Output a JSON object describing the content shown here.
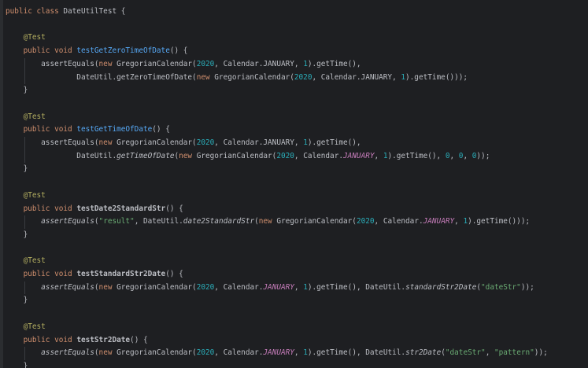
{
  "lines": [
    [
      {
        "t": "public class ",
        "c": "kw"
      },
      {
        "t": "DateUtilTest {",
        "c": "plain"
      }
    ],
    [],
    [
      {
        "t": "    @Test",
        "c": "ann"
      }
    ],
    [
      {
        "t": "    public void ",
        "c": "kw"
      },
      {
        "t": "testGetZeroTimeOfDate",
        "c": "fn"
      },
      {
        "t": "() {",
        "c": "plain"
      }
    ],
    [
      {
        "t": "        assertEquals(",
        "c": "plain"
      },
      {
        "t": "new ",
        "c": "kw"
      },
      {
        "t": "GregorianCalendar(",
        "c": "plain"
      },
      {
        "t": "2020",
        "c": "num"
      },
      {
        "t": ", Calendar.JANUARY, ",
        "c": "plain"
      },
      {
        "t": "1",
        "c": "num"
      },
      {
        "t": ").getTime(),",
        "c": "plain"
      }
    ],
    [
      {
        "t": "                DateUtil.getZeroTimeOfDate(",
        "c": "plain"
      },
      {
        "t": "new ",
        "c": "kw"
      },
      {
        "t": "GregorianCalendar(",
        "c": "plain"
      },
      {
        "t": "2020",
        "c": "num"
      },
      {
        "t": ", Calendar.JANUARY, ",
        "c": "plain"
      },
      {
        "t": "1",
        "c": "num"
      },
      {
        "t": ").getTime()));",
        "c": "plain"
      }
    ],
    [
      {
        "t": "    }",
        "c": "plain"
      }
    ],
    [],
    [
      {
        "t": "    @Test",
        "c": "ann"
      }
    ],
    [
      {
        "t": "    public void ",
        "c": "kw"
      },
      {
        "t": "testGetTimeOfDate",
        "c": "fn"
      },
      {
        "t": "() {",
        "c": "plain"
      }
    ],
    [
      {
        "t": "        assertEquals(",
        "c": "plain"
      },
      {
        "t": "new ",
        "c": "kw"
      },
      {
        "t": "GregorianCalendar(",
        "c": "plain"
      },
      {
        "t": "2020",
        "c": "num"
      },
      {
        "t": ", Calendar.JANUARY, ",
        "c": "plain"
      },
      {
        "t": "1",
        "c": "num"
      },
      {
        "t": ").getTime(),",
        "c": "plain"
      }
    ],
    [
      {
        "t": "                DateUtil.",
        "c": "plain"
      },
      {
        "t": "getTimeOfDate",
        "c": "sfn"
      },
      {
        "t": "(",
        "c": "plain"
      },
      {
        "t": "new ",
        "c": "kw"
      },
      {
        "t": "GregorianCalendar(",
        "c": "plain"
      },
      {
        "t": "2020",
        "c": "num"
      },
      {
        "t": ", Calendar.",
        "c": "plain"
      },
      {
        "t": "JANUARY",
        "c": "stat"
      },
      {
        "t": ", ",
        "c": "plain"
      },
      {
        "t": "1",
        "c": "num"
      },
      {
        "t": ").getTime(), ",
        "c": "plain"
      },
      {
        "t": "0",
        "c": "num"
      },
      {
        "t": ", ",
        "c": "plain"
      },
      {
        "t": "0",
        "c": "num"
      },
      {
        "t": ", ",
        "c": "plain"
      },
      {
        "t": "0",
        "c": "num"
      },
      {
        "t": "));",
        "c": "plain"
      }
    ],
    [
      {
        "t": "    }",
        "c": "plain"
      }
    ],
    [],
    [
      {
        "t": "    @Test",
        "c": "ann"
      }
    ],
    [
      {
        "t": "    public void ",
        "c": "kw"
      },
      {
        "t": "testDate2StandardStr",
        "c": "plain bold"
      },
      {
        "t": "() {",
        "c": "plain"
      }
    ],
    [
      {
        "t": "        ",
        "c": "plain"
      },
      {
        "t": "assertEquals",
        "c": "sfn"
      },
      {
        "t": "(",
        "c": "plain"
      },
      {
        "t": "\"result\"",
        "c": "str"
      },
      {
        "t": ", DateUtil.",
        "c": "plain"
      },
      {
        "t": "date2StandardStr",
        "c": "sfn"
      },
      {
        "t": "(",
        "c": "plain"
      },
      {
        "t": "new ",
        "c": "kw"
      },
      {
        "t": "GregorianCalendar(",
        "c": "plain"
      },
      {
        "t": "2020",
        "c": "num"
      },
      {
        "t": ", Calendar.",
        "c": "plain"
      },
      {
        "t": "JANUARY",
        "c": "stat"
      },
      {
        "t": ", ",
        "c": "plain"
      },
      {
        "t": "1",
        "c": "num"
      },
      {
        "t": ").getTime()));",
        "c": "plain"
      }
    ],
    [
      {
        "t": "    }",
        "c": "plain"
      }
    ],
    [],
    [
      {
        "t": "    @Test",
        "c": "ann"
      }
    ],
    [
      {
        "t": "    public void ",
        "c": "kw"
      },
      {
        "t": "testStandardStr2Date",
        "c": "plain bold"
      },
      {
        "t": "() {",
        "c": "plain"
      }
    ],
    [
      {
        "t": "        ",
        "c": "plain"
      },
      {
        "t": "assertEquals",
        "c": "sfn"
      },
      {
        "t": "(",
        "c": "plain"
      },
      {
        "t": "new ",
        "c": "kw"
      },
      {
        "t": "GregorianCalendar(",
        "c": "plain"
      },
      {
        "t": "2020",
        "c": "num"
      },
      {
        "t": ", Calendar.",
        "c": "plain"
      },
      {
        "t": "JANUARY",
        "c": "stat"
      },
      {
        "t": ", ",
        "c": "plain"
      },
      {
        "t": "1",
        "c": "num"
      },
      {
        "t": ").getTime(), DateUtil.",
        "c": "plain"
      },
      {
        "t": "standardStr2Date",
        "c": "sfn"
      },
      {
        "t": "(",
        "c": "plain"
      },
      {
        "t": "\"dateStr\"",
        "c": "str"
      },
      {
        "t": "));",
        "c": "plain"
      }
    ],
    [
      {
        "t": "    }",
        "c": "plain"
      }
    ],
    [],
    [
      {
        "t": "    @Test",
        "c": "ann"
      }
    ],
    [
      {
        "t": "    public void ",
        "c": "kw"
      },
      {
        "t": "testStr2Date",
        "c": "plain bold"
      },
      {
        "t": "() {",
        "c": "plain"
      }
    ],
    [
      {
        "t": "        ",
        "c": "plain"
      },
      {
        "t": "assertEquals",
        "c": "sfn"
      },
      {
        "t": "(",
        "c": "plain"
      },
      {
        "t": "new ",
        "c": "kw"
      },
      {
        "t": "GregorianCalendar(",
        "c": "plain"
      },
      {
        "t": "2020",
        "c": "num"
      },
      {
        "t": ", Calendar.",
        "c": "plain"
      },
      {
        "t": "JANUARY",
        "c": "stat"
      },
      {
        "t": ", ",
        "c": "plain"
      },
      {
        "t": "1",
        "c": "num"
      },
      {
        "t": ").getTime(), DateUtil.",
        "c": "plain"
      },
      {
        "t": "str2Date",
        "c": "sfn"
      },
      {
        "t": "(",
        "c": "plain"
      },
      {
        "t": "\"dateStr\"",
        "c": "str"
      },
      {
        "t": ", ",
        "c": "plain"
      },
      {
        "t": "\"pattern\"",
        "c": "str"
      },
      {
        "t": "));",
        "c": "plain"
      }
    ],
    [
      {
        "t": "    }",
        "c": "plain"
      }
    ]
  ],
  "colors": {
    "background": "#1e1f22",
    "keyword": "#cf8e6d",
    "annotation": "#b3ae60",
    "method": "#56a8f5",
    "number": "#2aacb8",
    "string": "#6aab73",
    "text": "#bcbec4",
    "static_field": "#c77dbb"
  }
}
